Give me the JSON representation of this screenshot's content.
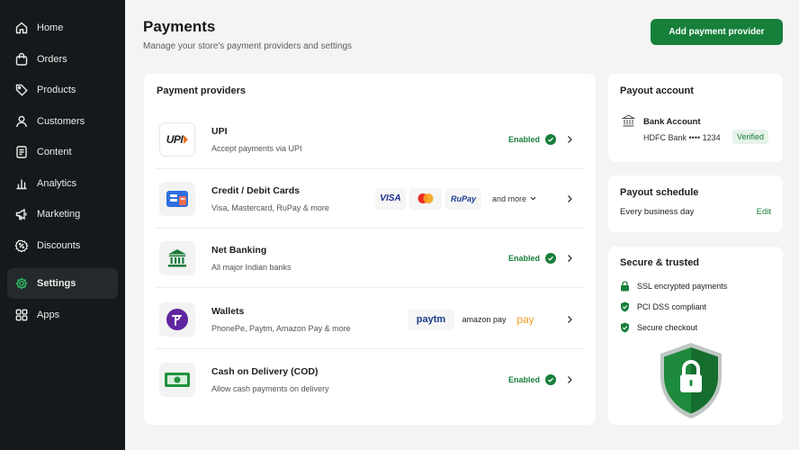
{
  "sidebar": {
    "items": [
      {
        "label": "Home",
        "icon": "home-icon"
      },
      {
        "label": "Orders",
        "icon": "bag-icon"
      },
      {
        "label": "Products",
        "icon": "tag-icon"
      },
      {
        "label": "Customers",
        "icon": "person-icon"
      },
      {
        "label": "Content",
        "icon": "document-icon"
      },
      {
        "label": "Analytics",
        "icon": "bar-chart-icon"
      },
      {
        "label": "Marketing",
        "icon": "megaphone-icon"
      },
      {
        "label": "Discounts",
        "icon": "discount-icon"
      },
      {
        "label": "Settings",
        "icon": "gear-icon",
        "active": true
      },
      {
        "label": "Apps",
        "icon": "apps-grid-icon"
      }
    ]
  },
  "header": {
    "title": "Payments",
    "subtitle": "Manage your store's payment providers and settings",
    "add_button": "Add payment provider"
  },
  "providers": {
    "title": "Payment providers",
    "rows": [
      {
        "name": "UPI",
        "desc": "Accept payments via UPI",
        "status": "Enabled",
        "logo": "UPI"
      },
      {
        "name": "Credit / Debit Cards",
        "desc": "Visa, Mastercard, RuPay & more",
        "brands": [
          "VISA",
          "Mastercard",
          "RuPay"
        ],
        "more": "and more"
      },
      {
        "name": "Net Banking",
        "desc": "All major Indian banks",
        "status": "Enabled"
      },
      {
        "name": "Wallets",
        "desc": "PhonePe, Paytm, Amazon Pay & more",
        "brands": [
          "paytm",
          "amazon pay",
          "pay"
        ]
      },
      {
        "name": "Cash on Delivery (COD)",
        "desc": "Allow cash payments on delivery",
        "status": "Enabled"
      }
    ]
  },
  "payout": {
    "title": "Payout account",
    "bank_name": "Bank Account",
    "bank_account": "HDFC Bank •••• 1234",
    "badge": "Verified"
  },
  "schedule": {
    "title": "Payout schedule",
    "value": "Every business day",
    "edit": "Edit"
  },
  "trusted": {
    "title": "Secure & trusted",
    "items": [
      "SSL encrypted payments",
      "PCI DSS compliant",
      "Secure checkout"
    ]
  },
  "colors": {
    "accent": "#16803a",
    "sidebar": "#16191b",
    "status": "#1a7f3c"
  }
}
